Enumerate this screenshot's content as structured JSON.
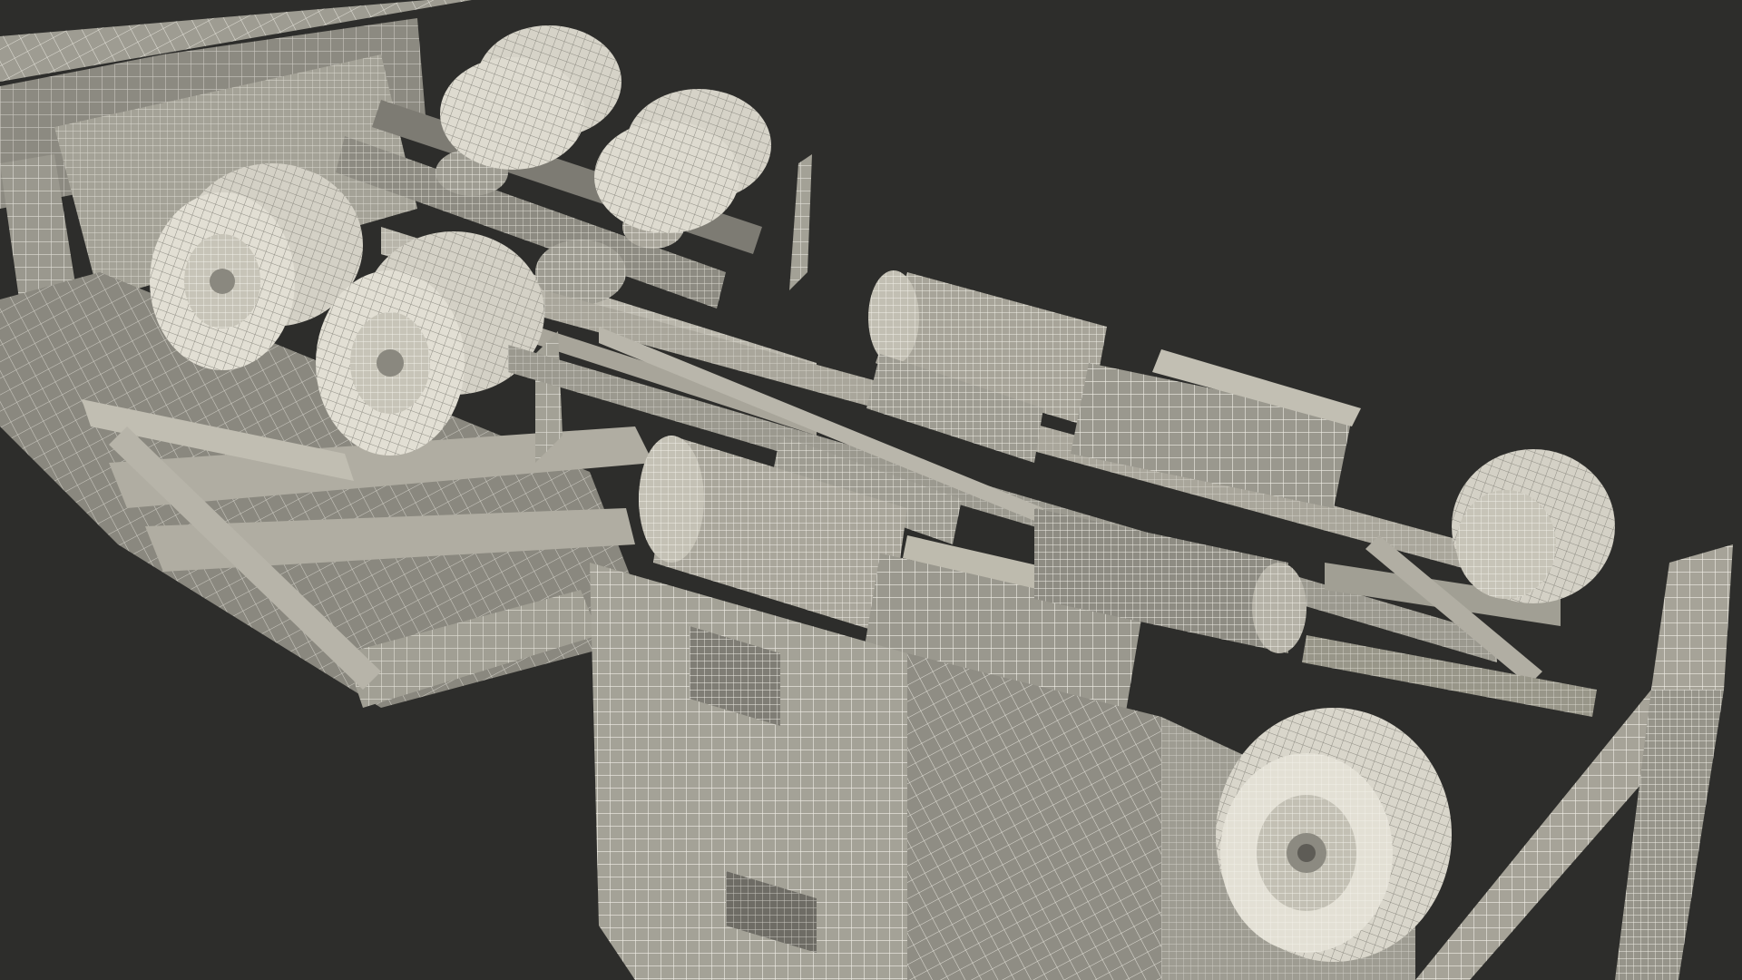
{
  "scene": {
    "subject": "truck-chassis-wireframe-underside",
    "colors": {
      "background": "#2d2d2b",
      "surface": "#a19f94",
      "surface_dark": "#77756c",
      "surface_light": "#c9c6ba",
      "tire": "#dddacf",
      "wire": "#f2f0e8",
      "shadow": "#4f4e48"
    }
  }
}
